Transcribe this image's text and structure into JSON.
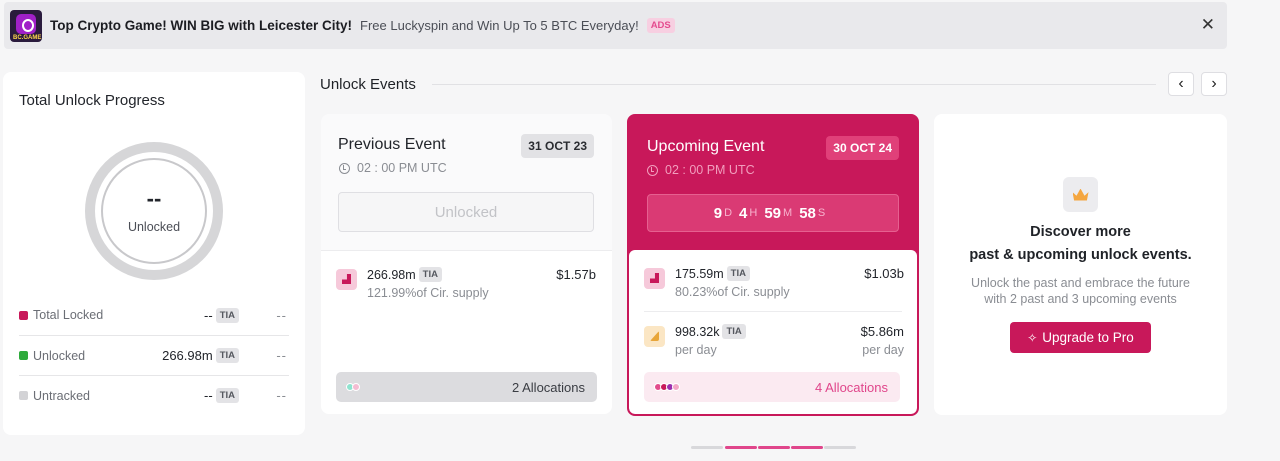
{
  "ad": {
    "logo_tag": "BC.GAME",
    "title": "Top Crypto Game! WIN BIG with Leicester City!",
    "description": "Free Luckyspin and Win Up To 5 BTC Everyday!",
    "badge": "ADS",
    "close": "✕"
  },
  "progress": {
    "title": "Total Unlock Progress",
    "ring_value": "--",
    "ring_label": "Unlocked",
    "legend": [
      {
        "label": "Total Locked",
        "value": "--",
        "unit": "TIA",
        "tail": "--",
        "color": "#c8185a"
      },
      {
        "label": "Unlocked",
        "value": "266.98m",
        "unit": "TIA",
        "tail": "--",
        "color": "#2eaa3c"
      },
      {
        "label": "Untracked",
        "value": "--",
        "unit": "TIA",
        "tail": "--",
        "color": "#d3d3d6"
      }
    ]
  },
  "events": {
    "title": "Unlock Events",
    "prev_nav": "‹",
    "next_nav": "›"
  },
  "previous": {
    "title": "Previous Event",
    "date": "31 OCT 23",
    "time": "02 : 00 PM UTC",
    "status": "Unlocked",
    "allocation": {
      "amount": "266.98m",
      "unit": "TIA",
      "sub": "121.99%of Cir. supply",
      "usd": "$1.57b"
    },
    "allocations_label": "2 Allocations",
    "dot_colors": [
      "#8fe3cf",
      "#f4bcd2"
    ]
  },
  "upcoming": {
    "title": "Upcoming Event",
    "date": "30 OCT 24",
    "time": "02 : 00 PM UTC",
    "countdown": {
      "d": "9",
      "d_u": "D",
      "h": "4",
      "h_u": "H",
      "m": "59",
      "m_u": "M",
      "s": "58",
      "s_u": "S"
    },
    "allocations": [
      {
        "amount": "175.59m",
        "unit": "TIA",
        "sub": "80.23%of Cir. supply",
        "usd": "$1.03b",
        "usd_sub": ""
      },
      {
        "amount": "998.32k",
        "unit": "TIA",
        "sub": "per day",
        "usd": "$5.86m",
        "usd_sub": "per day"
      }
    ],
    "allocations_label": "4 Allocations",
    "dot_colors": [
      "#e24c8c",
      "#c8185a",
      "#9b2fae",
      "#f3a6c6"
    ]
  },
  "pro": {
    "heading1": "Discover more",
    "heading2": "past & upcoming unlock events.",
    "desc1": "Unlock the past and embrace the future",
    "desc2": "with 2 past and 3 upcoming events",
    "button": "Upgrade to Pro",
    "button_icon": "✧"
  },
  "pager": {
    "active_color": "#e0468b",
    "inactive_color": "#d8d8db"
  }
}
